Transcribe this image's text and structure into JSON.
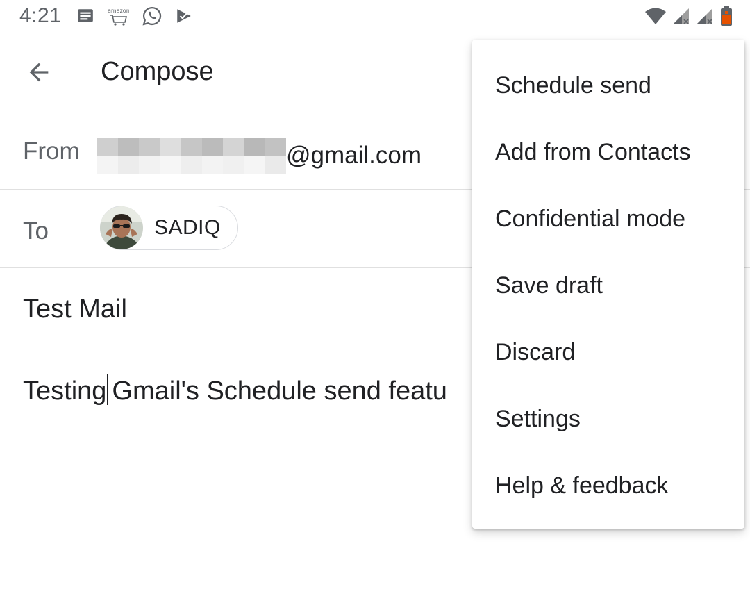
{
  "status_bar": {
    "time": "4:21",
    "left_icons": [
      "messages-icon",
      "amazon-icon",
      "whatsapp-icon",
      "tasks-icon"
    ],
    "right_icons": [
      "wifi-icon",
      "signal-icon",
      "signal-icon",
      "battery-icon"
    ]
  },
  "app_bar": {
    "back_icon": "arrow-back-icon",
    "title": "Compose"
  },
  "compose": {
    "from_label": "From",
    "from_email_suffix": "@gmail.com",
    "to_label": "To",
    "recipient_name": "SADIQ",
    "subject": "Test Mail",
    "body_before_cursor": "Testing",
    "body_after_cursor": "Gmail's Schedule send featu"
  },
  "menu": {
    "items": [
      "Schedule send",
      "Add from Contacts",
      "Confidential mode",
      "Save draft",
      "Discard",
      "Settings",
      "Help & feedback"
    ]
  },
  "colors": {
    "primary_text": "#202124",
    "secondary_text": "#5f6368",
    "divider": "#e0e0e0",
    "battery_accent": "#e65100"
  }
}
